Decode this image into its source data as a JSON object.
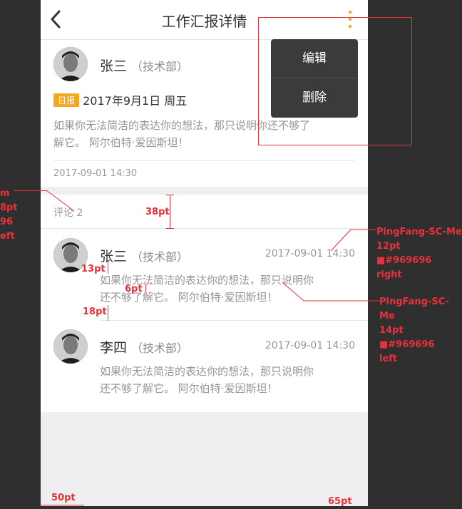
{
  "nav": {
    "title": "工作汇报详情"
  },
  "post": {
    "author": "张三",
    "dept": "（技术部）",
    "tag": "日报",
    "date": "2017年9月1日 周五",
    "body_line1": "如果你无法简洁的表达你的想法，那只说明你还不够了",
    "body_line2": "解它。 阿尔伯特·爱因斯坦！",
    "timestamp": "2017-09-01 14:30"
  },
  "comments_header": "评论 2",
  "comments": [
    {
      "author": "张三",
      "dept": "（技术部）",
      "time": "2017-09-01 14:30",
      "line1": "如果你无法简洁的表达你的想法，那只说明你",
      "line2": "还不够了解它。 阿尔伯特·爱因斯坦！"
    },
    {
      "author": "李四",
      "dept": "（技术部）",
      "time": "2017-09-01 14:30",
      "line1": "如果你无法简洁的表达你的想法，那只说明你",
      "line2": "还不够了解它。 阿尔伯特·爱因斯坦！"
    }
  ],
  "menu": {
    "edit": "编辑",
    "delete": "删除"
  },
  "annotations": {
    "left_1": "m",
    "left_2": "8pt",
    "left_3": "96",
    "left_4": "eft",
    "spacing_38": "38pt",
    "right_top_1": "PingFang-SC-Me",
    "right_top_2": "12pt",
    "right_top_3": "■#969696",
    "right_top_4": "right",
    "right_mid_1": "PingFang-SC-Me",
    "right_mid_2": "14pt",
    "right_mid_3": "■#969696",
    "right_mid_4": "left",
    "spacing_13": "13pt",
    "spacing_6": "6pt",
    "spacing_18": "18pt",
    "bottom_50": "50pt",
    "bottom_65": "65pt"
  },
  "colors": {
    "accent": "#f5a623",
    "annotation": "#e8313a",
    "muted_text": "#969696"
  }
}
